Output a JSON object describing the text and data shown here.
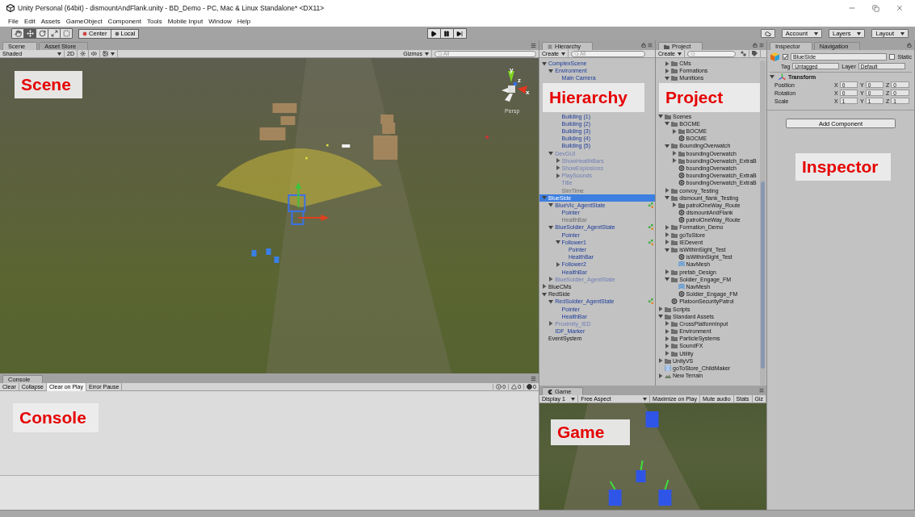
{
  "window": {
    "title": "Unity Personal (64bit) - dismountAndFlank.unity - BD_Demo - PC, Mac & Linux Standalone* <DX11>"
  },
  "menu": [
    "File",
    "Edit",
    "Assets",
    "GameObject",
    "Component",
    "Tools",
    "Mobile Input",
    "Window",
    "Help"
  ],
  "toolbar": {
    "tools": [
      {
        "kind": "hand",
        "selected": false
      },
      {
        "kind": "move",
        "selected": true
      },
      {
        "kind": "rotate",
        "selected": false
      },
      {
        "kind": "scale",
        "selected": false
      },
      {
        "kind": "rect",
        "selected": false
      }
    ],
    "pivot": [
      "Center",
      "Local"
    ],
    "playback": [
      {
        "kind": "play"
      },
      {
        "kind": "pause"
      },
      {
        "kind": "step"
      }
    ],
    "menus": [
      "Account",
      "Layers",
      "Layout"
    ]
  },
  "scene": {
    "tabs": [
      {
        "label": "Scene",
        "selected": true
      },
      {
        "label": "Asset Store",
        "selected": false
      }
    ],
    "shading": "Shaded",
    "mode_2d": "2D",
    "gizmos": "Gizmos",
    "search_placeholder": "All",
    "gizmo_labels": [
      "y",
      "z",
      "x"
    ],
    "projection": "Persp",
    "annotation": "Scene"
  },
  "hierarchy": {
    "title": "Hierarchy",
    "create": "Create",
    "search_placeholder": "All",
    "annotation": "Hierarchy",
    "items": [
      {
        "label": "ComplexScene",
        "kind": "prefab",
        "selected": false,
        "expanded": true,
        "children": [
          {
            "label": "Environment",
            "kind": "prefab",
            "selected": false,
            "expanded": true,
            "children": [
              {
                "label": "Main Camera",
                "kind": "prefab",
                "selected": false
              },
              {
                "label": "Building (1)",
                "kind": "prefab",
                "selected": false
              },
              {
                "label": "Building (2)",
                "kind": "prefab",
                "selected": false
              },
              {
                "label": "Building (3)",
                "kind": "prefab",
                "selected": false
              },
              {
                "label": "Building (4)",
                "kind": "prefab",
                "selected": false
              },
              {
                "label": "Building (5)",
                "kind": "prefab",
                "selected": false
              }
            ]
          },
          {
            "label": "DevGUI",
            "kind": "inactive_prefab",
            "selected": false,
            "expanded": true,
            "children": [
              {
                "label": "ShowHealthBars",
                "kind": "inactive_prefab",
                "selected": false,
                "expanded": false
              },
              {
                "label": "ShowExplosions",
                "kind": "inactive_prefab",
                "selected": false,
                "expanded": false
              },
              {
                "label": "PlaySounds",
                "kind": "inactive_prefab",
                "selected": false,
                "expanded": false
              },
              {
                "label": "Title",
                "kind": "inactive_prefab",
                "selected": false
              },
              {
                "label": "SimTime",
                "kind": "inactive",
                "selected": false
              }
            ]
          }
        ]
      },
      {
        "label": "BlueSide",
        "kind": "prefab",
        "selected": true,
        "expanded": true,
        "children": [
          {
            "label": "BlueVic_AgentState",
            "kind": "prefab",
            "selected": false,
            "expanded": true,
            "agent_marker": true,
            "children": [
              {
                "label": "Pointer",
                "kind": "prefab",
                "selected": false
              },
              {
                "label": "HealthBar",
                "kind": "inactive",
                "selected": false
              }
            ]
          },
          {
            "label": "BlueSoldier_AgentState",
            "kind": "prefab",
            "selected": false,
            "expanded": true,
            "agent_marker": true,
            "children": [
              {
                "label": "Pointer",
                "kind": "prefab",
                "selected": false
              },
              {
                "label": "Follower1",
                "kind": "prefab",
                "selected": false,
                "expanded": true,
                "agent_marker": true,
                "children": [
                  {
                    "label": "Pointer",
                    "kind": "prefab",
                    "selected": false
                  },
                  {
                    "label": "HealthBar",
                    "kind": "prefab",
                    "selected": false
                  }
                ]
              },
              {
                "label": "Follower2",
                "kind": "prefab",
                "selected": false,
                "expanded": false
              },
              {
                "label": "HealthBar",
                "kind": "prefab",
                "selected": false
              }
            ]
          },
          {
            "label": "BlueSoldier_AgentState",
            "kind": "inactive_prefab",
            "selected": false,
            "expanded": false
          }
        ]
      },
      {
        "label": "BlueCMs",
        "kind": "object",
        "selected": false,
        "expanded": false
      },
      {
        "label": "RedSide",
        "kind": "object",
        "selected": false,
        "expanded": true,
        "children": [
          {
            "label": "RedSoldier_AgentState",
            "kind": "prefab",
            "selected": false,
            "expanded": true,
            "agent_marker": true,
            "children": [
              {
                "label": "Pointer",
                "kind": "prefab",
                "selected": false
              },
              {
                "label": "HealthBar",
                "kind": "prefab",
                "selected": false
              }
            ]
          },
          {
            "label": "Proximity_IED",
            "kind": "inactive_prefab",
            "selected": false,
            "expanded": false
          },
          {
            "label": "IDF_Marker",
            "kind": "prefab",
            "selected": false
          }
        ]
      },
      {
        "label": "EventSystem",
        "kind": "object",
        "selected": false
      }
    ]
  },
  "project": {
    "title": "Project",
    "create": "Create",
    "annotation": "Project",
    "items_above": [
      {
        "label": "CMs",
        "kind": "folder",
        "selected": false,
        "expanded": false
      },
      {
        "label": "Formations",
        "kind": "folder",
        "selected": false,
        "expanded": false
      },
      {
        "label": "Munitions",
        "kind": "folder",
        "selected": false,
        "expanded": true
      }
    ],
    "items": [
      {
        "label": "Scenes",
        "kind": "folder",
        "selected": false,
        "expanded": true,
        "children": [
          {
            "label": "BOCME",
            "kind": "folder",
            "selected": false,
            "expanded": true,
            "children": [
              {
                "label": "BOCME",
                "kind": "folder",
                "selected": false,
                "expanded": false
              },
              {
                "label": "BOCME",
                "kind": "scene",
                "selected": false
              }
            ]
          },
          {
            "label": "BoundingOverwatch",
            "kind": "folder",
            "selected": false,
            "expanded": true,
            "children": [
              {
                "label": "boundingOverwatch",
                "kind": "folder",
                "selected": false,
                "expanded": false
              },
              {
                "label": "boundingOverwatch_ExtraB",
                "kind": "folder",
                "selected": false,
                "expanded": false
              },
              {
                "label": "boundingOverwatch",
                "kind": "scene",
                "selected": false
              },
              {
                "label": "boundingOverwatch_ExtraB",
                "kind": "scene",
                "selected": false
              },
              {
                "label": "boundingOverwatch_ExtraB",
                "kind": "scene",
                "selected": false
              }
            ]
          },
          {
            "label": "convoy_Testing",
            "kind": "folder",
            "selected": false,
            "expanded": false
          },
          {
            "label": "dismount_flank_Testing",
            "kind": "folder",
            "selected": false,
            "expanded": true,
            "children": [
              {
                "label": "patrolOneWay_Route",
                "kind": "folder",
                "selected": false,
                "expanded": false
              },
              {
                "label": "dismountAndFlank",
                "kind": "scene",
                "selected": false
              },
              {
                "label": "patrolOneWay_Route",
                "kind": "scene",
                "selected": false
              }
            ]
          },
          {
            "label": "Formation_Demo",
            "kind": "folder",
            "selected": false,
            "expanded": false
          },
          {
            "label": "goToStore",
            "kind": "folder",
            "selected": false,
            "expanded": false
          },
          {
            "label": "IEDevent",
            "kind": "folder",
            "selected": false,
            "expanded": false
          },
          {
            "label": "isWithinSight_Test",
            "kind": "folder",
            "selected": false,
            "expanded": true,
            "children": [
              {
                "label": "isWithinSight_Test",
                "kind": "scene",
                "selected": false
              },
              {
                "label": "NavMesh",
                "kind": "navmesh",
                "selected": false
              }
            ]
          },
          {
            "label": "prefab_Design",
            "kind": "folder",
            "selected": false,
            "expanded": false
          },
          {
            "label": "Soldier_Engage_FM",
            "kind": "folder",
            "selected": false,
            "expanded": true,
            "children": [
              {
                "label": "NavMesh",
                "kind": "navmesh",
                "selected": false
              },
              {
                "label": "Soldier_Engage_FM",
                "kind": "scene",
                "selected": false
              }
            ]
          },
          {
            "label": "PlatoonSecurityPatrol",
            "kind": "scene",
            "selected": false
          }
        ]
      },
      {
        "label": "Scripts",
        "kind": "folder",
        "selected": false,
        "expanded": false
      },
      {
        "label": "Standard Assets",
        "kind": "folder",
        "selected": false,
        "expanded": true,
        "children": [
          {
            "label": "CrossPlatformInput",
            "kind": "folder",
            "selected": false,
            "expanded": false
          },
          {
            "label": "Environment",
            "kind": "folder",
            "selected": false,
            "expanded": false
          },
          {
            "label": "ParticleSystems",
            "kind": "folder",
            "selected": false,
            "expanded": false
          },
          {
            "label": "SoundFX",
            "kind": "folder",
            "selected": false,
            "expanded": false
          },
          {
            "label": "Utility",
            "kind": "folder",
            "selected": false,
            "expanded": false
          }
        ]
      },
      {
        "label": "UnityVS",
        "kind": "folder",
        "selected": false,
        "expanded": false
      },
      {
        "label": "goToStore_ChildMaker",
        "kind": "script",
        "selected": false
      },
      {
        "label": "New Terrain",
        "kind": "terrain",
        "selected": false,
        "expanded": false
      }
    ]
  },
  "inspector": {
    "tabs": [
      {
        "label": "Inspector",
        "selected": true
      },
      {
        "label": "Navigation",
        "selected": false
      }
    ],
    "object": {
      "name": "BlueSide",
      "active": true,
      "static_label": "Static",
      "static": false,
      "tag_label": "Tag",
      "tag": "Untagged",
      "layer_label": "Layer",
      "layer": "Default"
    },
    "component": {
      "title": "Transform",
      "expanded": true,
      "rows": [
        {
          "label": "Position",
          "values": [
            {
              "axis": "X",
              "value": "0"
            },
            {
              "axis": "Y",
              "value": "0"
            },
            {
              "axis": "Z",
              "value": "0"
            }
          ]
        },
        {
          "label": "Rotation",
          "values": [
            {
              "axis": "X",
              "value": "0"
            },
            {
              "axis": "Y",
              "value": "0"
            },
            {
              "axis": "Z",
              "value": "0"
            }
          ]
        },
        {
          "label": "Scale",
          "values": [
            {
              "axis": "X",
              "value": "1"
            },
            {
              "axis": "Y",
              "value": "1"
            },
            {
              "axis": "Z",
              "value": "1"
            }
          ]
        }
      ]
    },
    "add_component": "Add Component",
    "annotation": "Inspector"
  },
  "console": {
    "title": "Console",
    "buttons": [
      {
        "label": "Clear",
        "selected": false
      },
      {
        "label": "Collapse",
        "selected": false
      },
      {
        "label": "Clear on Play",
        "selected": true
      },
      {
        "label": "Error Pause",
        "selected": false
      }
    ],
    "counts": [
      {
        "kind": "info",
        "count": "0"
      },
      {
        "kind": "warning",
        "count": "0"
      },
      {
        "kind": "error",
        "count": "0"
      }
    ],
    "annotation": "Console"
  },
  "game": {
    "title": "Game",
    "display": "Display 1",
    "aspect": "Free Aspect",
    "buttons": [
      "Maximize on Play",
      "Mute audio",
      "Stats",
      "Giz"
    ],
    "annotation": "Game"
  }
}
